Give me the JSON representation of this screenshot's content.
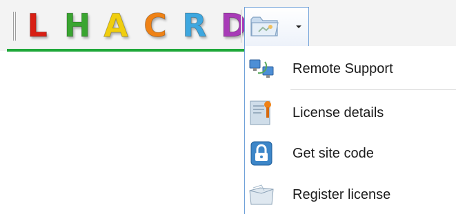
{
  "toolbar": {
    "letters": [
      {
        "char": "L",
        "color": "#d81f14"
      },
      {
        "char": "H",
        "color": "#3aa531"
      },
      {
        "char": "A",
        "color": "#f0ce0f"
      },
      {
        "char": "C",
        "color": "#ef8216"
      },
      {
        "char": "R",
        "color": "#3ea7df"
      },
      {
        "char": "D",
        "color": "#a83bb7"
      }
    ],
    "accent_underline_color": "#1fa83a",
    "dropdown_icon": "folder-icon"
  },
  "menu": {
    "items": [
      {
        "label": "Remote Support",
        "icon": "remote-support-icon"
      },
      {
        "label": "License details",
        "icon": "license-details-icon"
      },
      {
        "label": "Get site code",
        "icon": "lock-icon"
      },
      {
        "label": "Register license",
        "icon": "register-folder-icon"
      }
    ]
  }
}
